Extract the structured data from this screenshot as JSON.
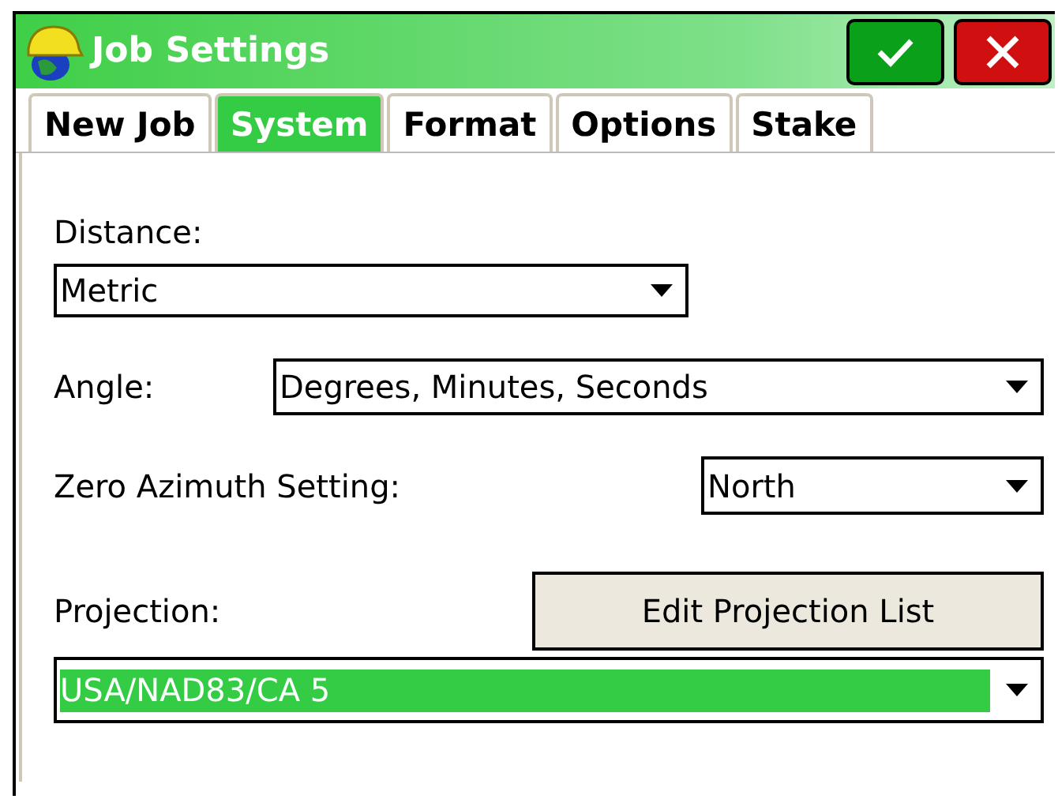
{
  "window": {
    "title": "Job Settings"
  },
  "tabs": [
    {
      "label": "New Job",
      "selected": false
    },
    {
      "label": "System",
      "selected": true
    },
    {
      "label": "Format",
      "selected": false
    },
    {
      "label": "Options",
      "selected": false
    },
    {
      "label": "Stake",
      "selected": false
    }
  ],
  "settings": [
    {
      "kind": "stacked",
      "label": "Distance:",
      "dropdown": {
        "value": "Metric",
        "focused": false
      }
    },
    {
      "kind": "inline-wide",
      "label": "Angle:",
      "dropdown": {
        "value": "Degrees, Minutes, Seconds",
        "focused": false
      }
    },
    {
      "kind": "inline-narrow",
      "label": "Zero Azimuth Setting:",
      "dropdown": {
        "value": "North",
        "focused": false
      }
    },
    {
      "kind": "stacked-button",
      "label": "Projection:",
      "button": "Edit Projection List",
      "dropdown": {
        "value": "USA/NAD83/CA 5",
        "focused": true
      }
    }
  ]
}
